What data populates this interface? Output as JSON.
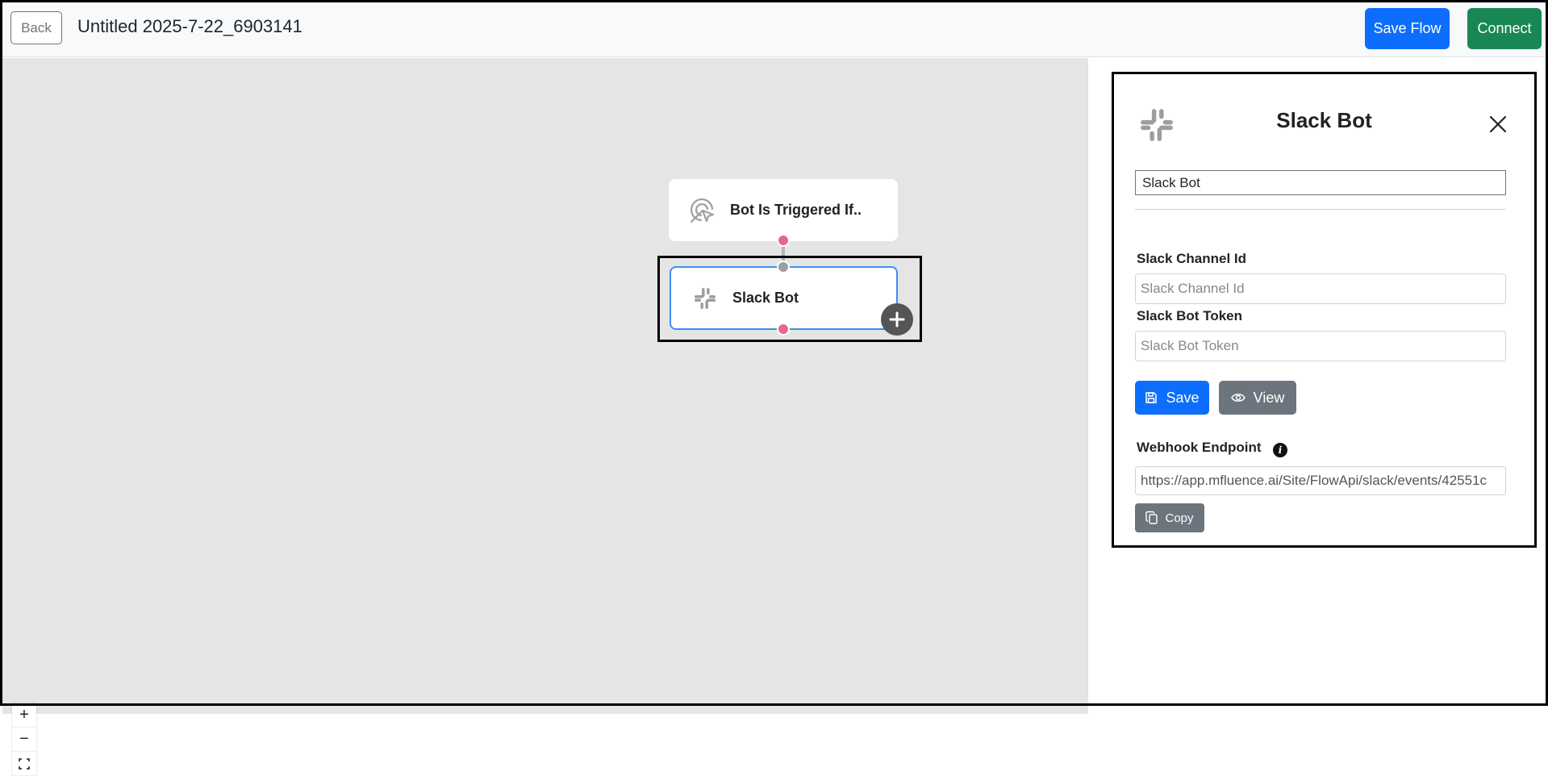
{
  "header": {
    "back_label": "Back",
    "flow_title": "Untitled 2025-7-22_6903141",
    "save_flow_label": "Save Flow",
    "connect_label": "Connect"
  },
  "canvas": {
    "nodes": [
      {
        "label": "Bot Is Triggered If..",
        "icon": "trigger-icon"
      },
      {
        "label": "Slack Bot",
        "icon": "slack-icon"
      }
    ],
    "zoom_controls": {
      "zoom_in": "+",
      "zoom_out": "−"
    }
  },
  "panel": {
    "title": "Slack Bot",
    "icon": "slack-icon",
    "name_value": "Slack Bot",
    "channel_label": "Slack Channel Id",
    "channel_placeholder": "Slack Channel Id",
    "token_label": "Slack Bot Token",
    "token_placeholder": "Slack Bot Token",
    "save_label": "Save",
    "view_label": "View",
    "webhook_label": "Webhook Endpoint",
    "info_icon": "i",
    "webhook_value": "https://app.mfluence.ai/Site/FlowApi/slack/events/42551c",
    "copy_label": "Copy"
  },
  "colors": {
    "primary": "#0d6efd",
    "success": "#198754",
    "secondary": "#6c757d",
    "handle_pink": "#e8678a",
    "node_selected_border": "#3b8ff5",
    "canvas_bg": "#e5e5e5"
  }
}
